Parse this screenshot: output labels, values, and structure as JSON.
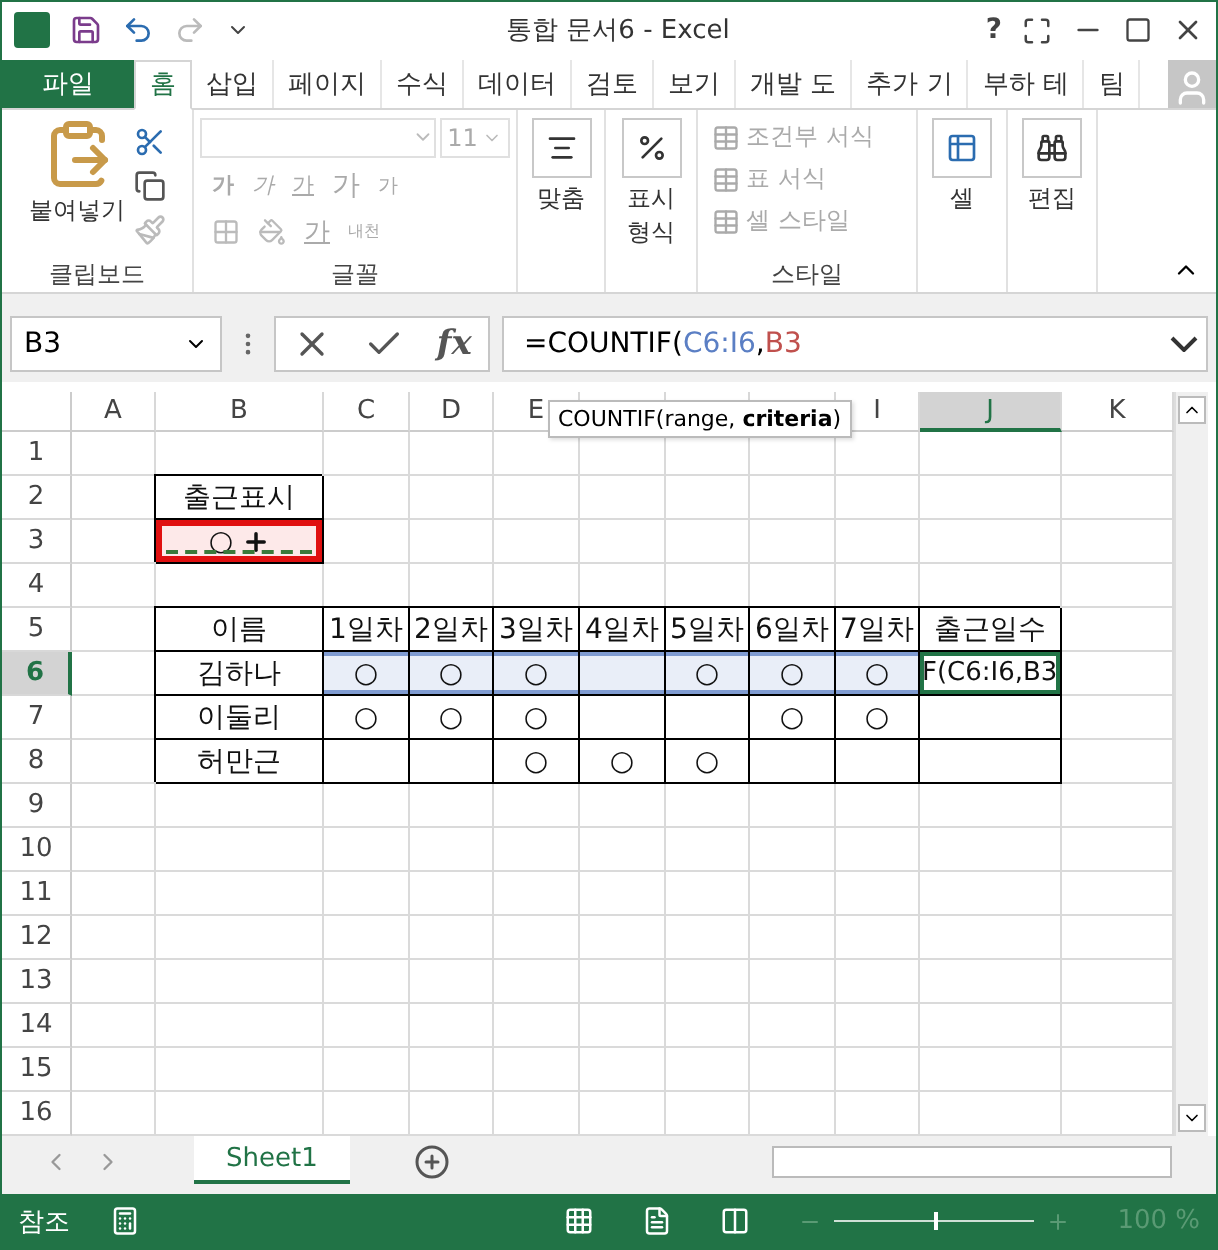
{
  "window": {
    "title": "통합 문서6 - Excel",
    "help": "?"
  },
  "tabs": [
    {
      "label": "파일",
      "kind": "file",
      "selected": false
    },
    {
      "label": "홈",
      "kind": "tab",
      "selected": true
    },
    {
      "label": "삽입",
      "kind": "tab",
      "selected": false
    },
    {
      "label": "페이지",
      "kind": "tab",
      "selected": false
    },
    {
      "label": "수식",
      "kind": "tab",
      "selected": false
    },
    {
      "label": "데이터",
      "kind": "tab",
      "selected": false
    },
    {
      "label": "검토",
      "kind": "tab",
      "selected": false
    },
    {
      "label": "보기",
      "kind": "tab",
      "selected": false
    },
    {
      "label": "개발 도",
      "kind": "tab",
      "selected": false
    },
    {
      "label": "추가 기",
      "kind": "tab",
      "selected": false
    },
    {
      "label": "부하 테",
      "kind": "tab",
      "selected": false
    },
    {
      "label": "팀",
      "kind": "tab",
      "selected": false
    }
  ],
  "ribbon": {
    "clipboard": {
      "paste": "붙여넣기",
      "label": "클립보드"
    },
    "font": {
      "size": "11",
      "bold": "가",
      "italic": "가",
      "underline": "가",
      "grow": "가",
      "shrink": "가",
      "font_color": "가",
      "phonetic": "내천",
      "label": "글꼴",
      "disabled": true
    },
    "alignment": {
      "label": "맞춤"
    },
    "number": {
      "label": "표시 형식"
    },
    "styles": {
      "items": [
        {
          "label": "조건부 서식",
          "disabled": true
        },
        {
          "label": "표 서식",
          "disabled": true
        },
        {
          "label": "셀 스타일",
          "disabled": true
        }
      ],
      "label": "스타일"
    },
    "cells": {
      "label": "셀"
    },
    "editing": {
      "label": "편집"
    }
  },
  "formula_bar": {
    "name_box": "B3",
    "fx": "fx",
    "parts": [
      {
        "text": "=COUNTIF(",
        "color": "#000000"
      },
      {
        "text": "C6:I6",
        "color": "#5b7fc4"
      },
      {
        "prefix": ",",
        "text": "B3",
        "color": "#c0504d"
      }
    ],
    "tooltip": "COUNTIF(range, **criteria**)"
  },
  "columns": [
    {
      "label": "A",
      "selected": false
    },
    {
      "label": "B",
      "selected": false
    },
    {
      "label": "C",
      "selected": false
    },
    {
      "label": "D",
      "selected": false
    },
    {
      "label": "E",
      "selected": false
    },
    {
      "selected": false
    },
    {
      "selected": false
    },
    {
      "selected": false
    },
    {
      "label": "I",
      "selected": false
    },
    {
      "label": "J",
      "selected": true
    },
    {
      "label": "K",
      "selected": false
    }
  ],
  "rows": [
    {
      "label": "1",
      "selected": false
    },
    {
      "label": "2",
      "selected": false,
      "cells": [
        {},
        {
          "text": "출근표시",
          "bordered": true
        }
      ]
    },
    {
      "label": "3",
      "selected": false,
      "cells": [
        {},
        {
          "text": "○",
          "bordered": true,
          "marked": true,
          "copied": true
        }
      ]
    },
    {
      "label": "4",
      "selected": false
    },
    {
      "label": "5",
      "selected": false,
      "cells": [
        {},
        {
          "text": "이름",
          "bordered": true
        },
        {
          "text": "1일차",
          "bordered": true
        },
        {
          "text": "2일차",
          "bordered": true
        },
        {
          "text": "3일차",
          "bordered": true
        },
        {
          "text": "4일차",
          "bordered": true
        },
        {
          "text": "5일차",
          "bordered": true
        },
        {
          "text": "6일차",
          "bordered": true
        },
        {
          "text": "7일차",
          "bordered": true
        },
        {
          "text": "출근일수",
          "bordered": true
        }
      ]
    },
    {
      "label": "6",
      "selected": true,
      "cells": [
        {},
        {
          "text": "김하나",
          "bordered": true
        },
        {
          "text": "○",
          "bordered": true,
          "in_range": true
        },
        {
          "text": "○",
          "bordered": true,
          "in_range": true
        },
        {
          "text": "○",
          "bordered": true,
          "in_range": true
        },
        {
          "bordered": true,
          "in_range": true
        },
        {
          "text": "○",
          "bordered": true,
          "in_range": true
        },
        {
          "text": "○",
          "bordered": true,
          "in_range": true
        },
        {
          "text": "○",
          "bordered": true,
          "in_range": true
        },
        {
          "text": "F(C6:I6,B3",
          "bordered": true,
          "active": true
        }
      ]
    },
    {
      "label": "7",
      "selected": false,
      "cells": [
        {},
        {
          "text": "이둘리",
          "bordered": true
        },
        {
          "text": "○",
          "bordered": true
        },
        {
          "text": "○",
          "bordered": true
        },
        {
          "text": "○",
          "bordered": true
        },
        {
          "bordered": true
        },
        {
          "bordered": true
        },
        {
          "text": "○",
          "bordered": true
        },
        {
          "text": "○",
          "bordered": true
        },
        {
          "bordered": true
        }
      ]
    },
    {
      "label": "8",
      "selected": false,
      "cells": [
        {},
        {
          "text": "허만근",
          "bordered": true
        },
        {
          "bordered": true
        },
        {
          "bordered": true
        },
        {
          "text": "○",
          "bordered": true
        },
        {
          "text": "○",
          "bordered": true
        },
        {
          "text": "○",
          "bordered": true
        },
        {
          "bordered": true
        },
        {
          "bordered": true
        },
        {
          "bordered": true
        }
      ]
    },
    {
      "label": "9",
      "selected": false
    },
    {
      "label": "10",
      "selected": false
    },
    {
      "label": "11",
      "selected": false
    },
    {
      "label": "12",
      "selected": false
    },
    {
      "label": "13",
      "selected": false
    },
    {
      "label": "14",
      "selected": false
    },
    {
      "label": "15",
      "selected": false
    },
    {
      "label": "16",
      "selected": false
    }
  ],
  "sheets": [
    {
      "label": "Sheet1",
      "selected": true
    }
  ],
  "status_bar": {
    "mode": "참조",
    "zoom": {
      "level": 0.5,
      "reading": "100 %"
    }
  }
}
